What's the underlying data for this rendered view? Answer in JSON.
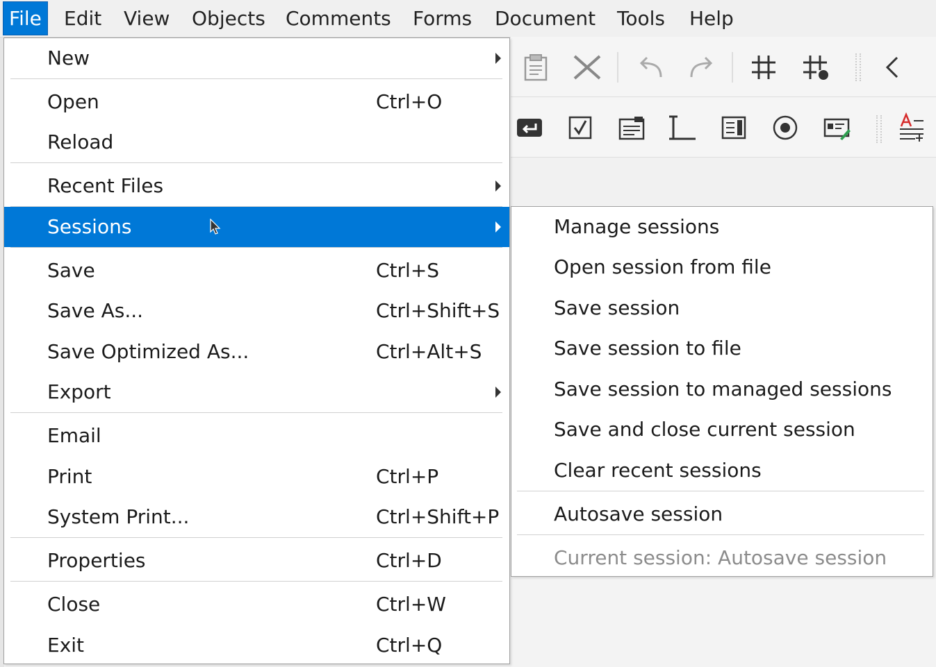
{
  "menubar": {
    "items": [
      "File",
      "Edit",
      "View",
      "Objects",
      "Comments",
      "Forms",
      "Document",
      "Tools",
      "Help"
    ]
  },
  "file_menu": {
    "items": [
      {
        "label": "New",
        "shortcut": "",
        "submenu": true
      },
      {
        "label": "Open",
        "shortcut": "Ctrl+O"
      },
      {
        "label": "Reload",
        "shortcut": ""
      },
      {
        "label": "Recent Files",
        "shortcut": "",
        "submenu": true
      },
      {
        "label": "Sessions",
        "shortcut": "",
        "submenu": true,
        "highlighted": true
      },
      {
        "label": "Save",
        "shortcut": "Ctrl+S"
      },
      {
        "label": "Save As...",
        "shortcut": "Ctrl+Shift+S"
      },
      {
        "label": "Save Optimized As...",
        "shortcut": "Ctrl+Alt+S"
      },
      {
        "label": "Export",
        "shortcut": "",
        "submenu": true
      },
      {
        "label": "Email",
        "shortcut": ""
      },
      {
        "label": "Print",
        "shortcut": "Ctrl+P"
      },
      {
        "label": "System Print...",
        "shortcut": "Ctrl+Shift+P"
      },
      {
        "label": "Properties",
        "shortcut": "Ctrl+D"
      },
      {
        "label": "Close",
        "shortcut": "Ctrl+W"
      },
      {
        "label": "Exit",
        "shortcut": "Ctrl+Q"
      }
    ]
  },
  "sessions_menu": {
    "items": [
      {
        "label": "Manage sessions"
      },
      {
        "label": "Open session from file"
      },
      {
        "label": "Save session"
      },
      {
        "label": "Save session to file"
      },
      {
        "label": "Save session to managed sessions"
      },
      {
        "label": "Save and close current session"
      },
      {
        "label": "Clear recent sessions"
      },
      {
        "label": "Autosave session"
      },
      {
        "label": "Current session: Autosave session",
        "disabled": true
      }
    ]
  },
  "colors": {
    "highlight": "#0078d7",
    "menu_bg": "#ffffff",
    "disabled_text": "#8c8c8c"
  },
  "toolbar_icons": {
    "row1": [
      "paste-icon",
      "delete-icon",
      "undo-icon",
      "redo-icon",
      "grid-icon",
      "snap-grid-icon",
      "collapse-left-icon"
    ],
    "row2": [
      "button-field-icon",
      "checkbox-field-icon",
      "combobox-field-icon",
      "text-field-icon",
      "listbox-field-icon",
      "radio-field-icon",
      "signature-field-icon",
      "text-format-icon"
    ]
  }
}
